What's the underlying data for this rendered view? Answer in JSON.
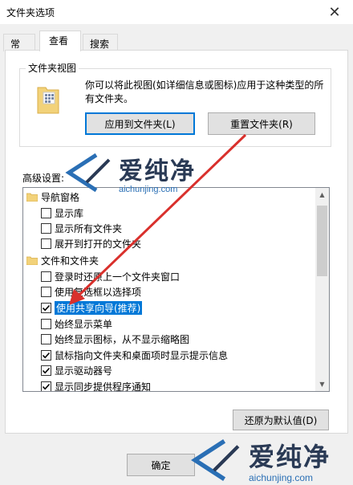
{
  "window": {
    "title": "文件夹选项",
    "close_glyph": "✕"
  },
  "tabs": [
    {
      "label": "常规",
      "active": false
    },
    {
      "label": "查看",
      "active": true
    },
    {
      "label": "搜索",
      "active": false
    }
  ],
  "folder_views": {
    "group_label": "文件夹视图",
    "description": "你可以将此视图(如详细信息或图标)应用于这种类型的所有文件夹。",
    "apply_button": "应用到文件夹(L)",
    "reset_button": "重置文件夹(R)"
  },
  "advanced": {
    "label": "高级设置:",
    "items": [
      {
        "type": "folder",
        "label": "导航窗格",
        "indent": 0
      },
      {
        "type": "checkbox",
        "label": "显示库",
        "checked": false,
        "indent": 1
      },
      {
        "type": "checkbox",
        "label": "显示所有文件夹",
        "checked": false,
        "indent": 1
      },
      {
        "type": "checkbox",
        "label": "展开到打开的文件夹",
        "checked": false,
        "indent": 1
      },
      {
        "type": "folder",
        "label": "文件和文件夹",
        "indent": 0
      },
      {
        "type": "checkbox",
        "label": "登录时还原上一个文件夹窗口",
        "checked": false,
        "indent": 1
      },
      {
        "type": "checkbox",
        "label": "使用复选框以选择项",
        "checked": false,
        "indent": 1
      },
      {
        "type": "checkbox",
        "label": "使用共享向导(推荐)",
        "checked": true,
        "indent": 1,
        "highlighted": true
      },
      {
        "type": "checkbox",
        "label": "始终显示菜单",
        "checked": false,
        "indent": 1
      },
      {
        "type": "checkbox",
        "label": "始终显示图标，从不显示缩略图",
        "checked": false,
        "indent": 1
      },
      {
        "type": "checkbox",
        "label": "鼠标指向文件夹和桌面项时显示提示信息",
        "checked": true,
        "indent": 1
      },
      {
        "type": "checkbox",
        "label": "显示驱动器号",
        "checked": true,
        "indent": 1
      },
      {
        "type": "checkbox",
        "label": "显示同步提供程序通知",
        "checked": true,
        "indent": 1
      }
    ],
    "restore_button": "还原为默认值(D)"
  },
  "footer": {
    "ok_button": "确定"
  },
  "watermark": {
    "brand": "爱纯净",
    "url": "aichunjing.com"
  },
  "colors": {
    "accent": "#0078d7",
    "arrow": "#d9302c"
  }
}
